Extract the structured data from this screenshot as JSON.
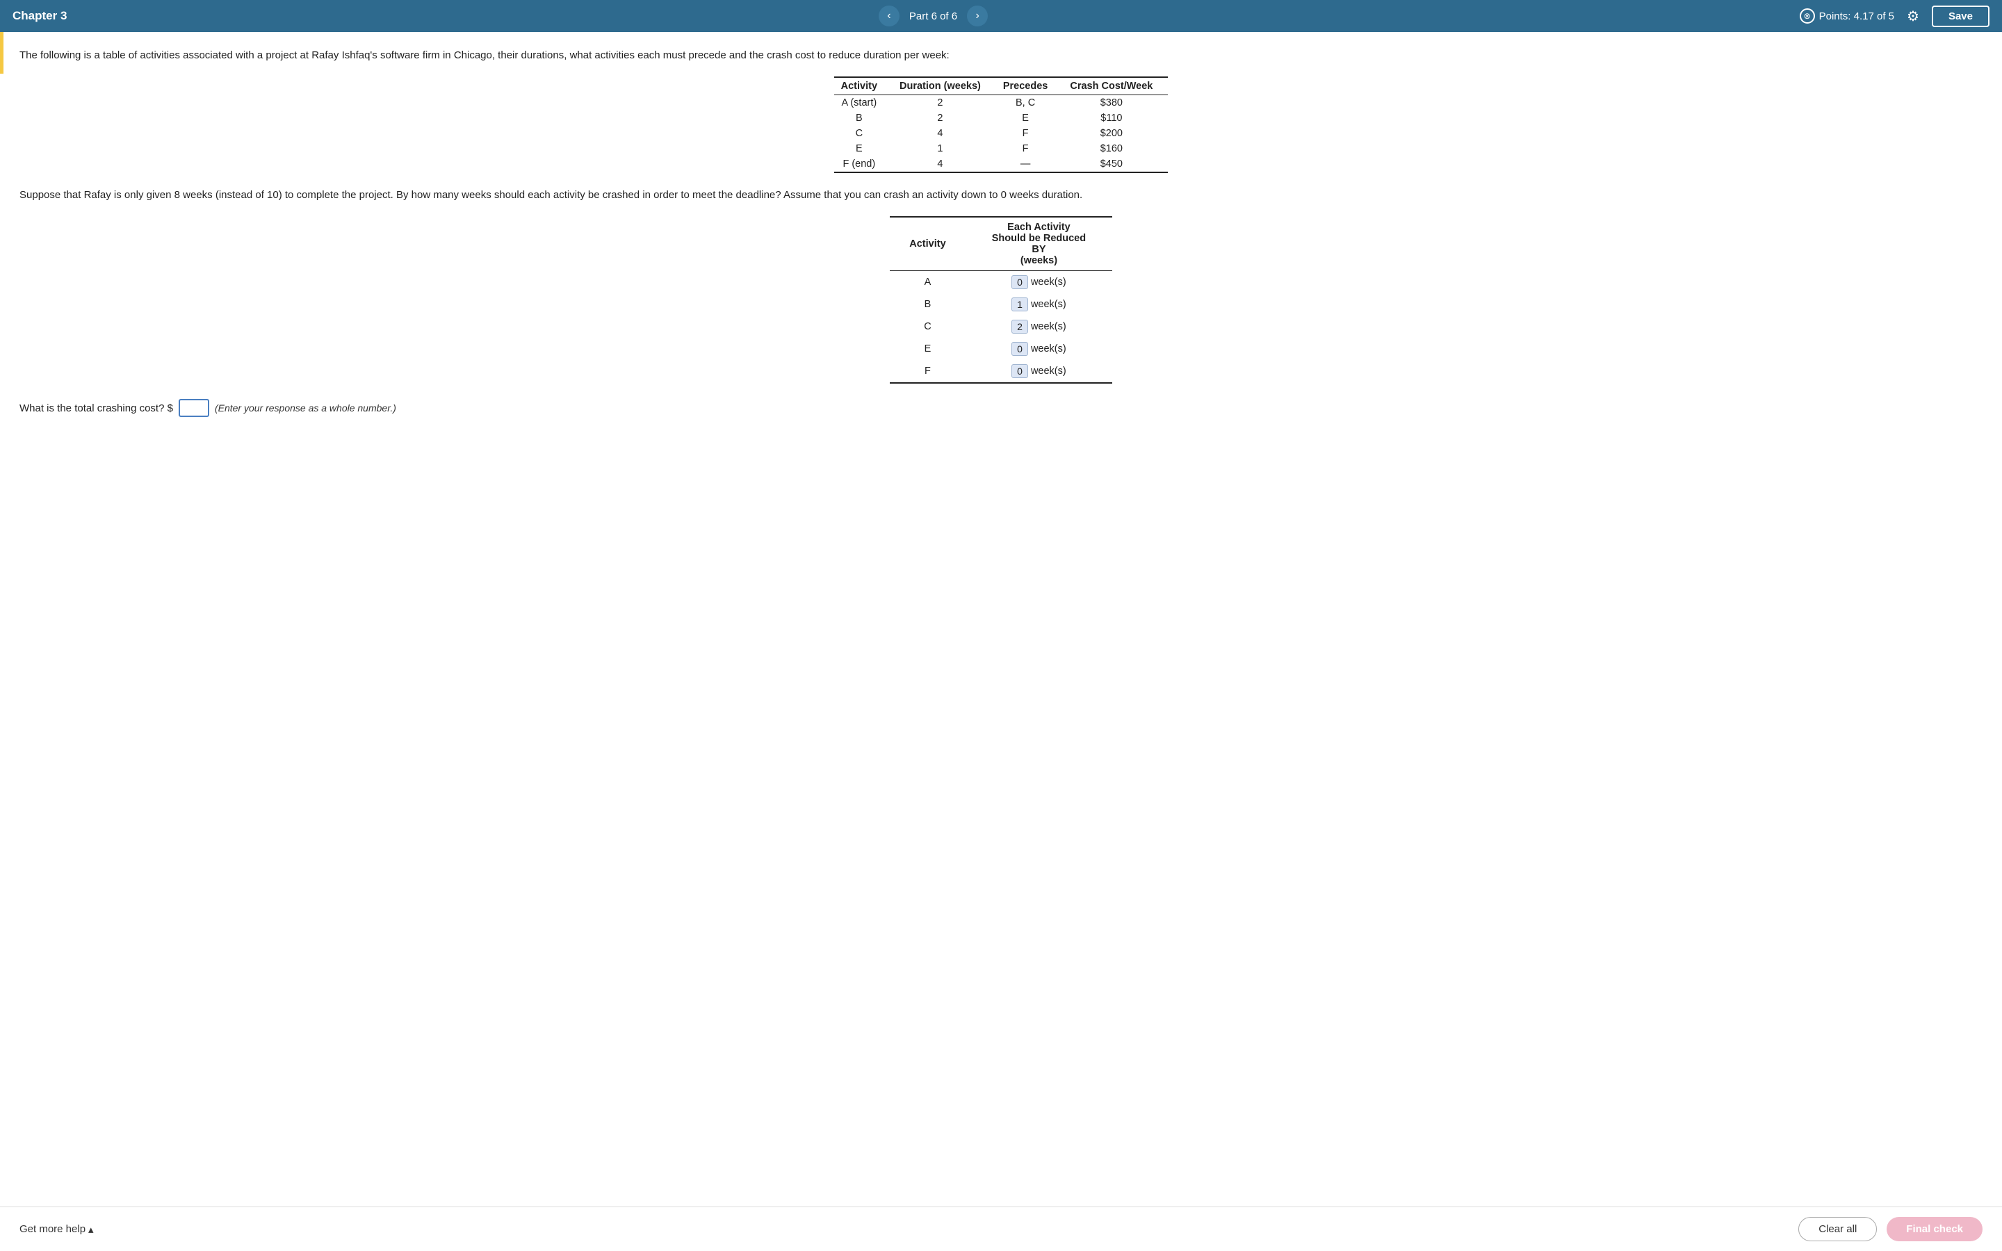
{
  "header": {
    "chapter": "Chapter 3",
    "part": "Part 6 of 6",
    "points_label": "Points: 4.17 of 5",
    "save_label": "Save"
  },
  "question_text": "The following is a table of activities associated with a project at Rafay Ishfaq's software firm in Chicago, their durations, what activities each must precede and the crash cost to reduce duration per week:",
  "activity_table": {
    "headers": [
      "Activity",
      "Duration (weeks)",
      "Precedes",
      "Crash Cost/Week"
    ],
    "rows": [
      [
        "A (start)",
        "2",
        "B, C",
        "$380"
      ],
      [
        "B",
        "2",
        "E",
        "$110"
      ],
      [
        "C",
        "4",
        "F",
        "$200"
      ],
      [
        "E",
        "1",
        "F",
        "$160"
      ],
      [
        "F (end)",
        "4",
        "—",
        "$450"
      ]
    ]
  },
  "suppose_text": "Suppose that Rafay is only given 8 weeks (instead of 10) to complete the project. By how many weeks should each activity be crashed in order to meet the deadline? Assume that you can crash an activity down to 0 weeks duration.",
  "reduction_table": {
    "col1_header": "Activity",
    "col2_header": "Each Activity Should be Reduced BY (weeks)",
    "rows": [
      {
        "activity": "A",
        "value": "0",
        "unit": "week(s)"
      },
      {
        "activity": "B",
        "value": "1",
        "unit": "week(s)"
      },
      {
        "activity": "C",
        "value": "2",
        "unit": "week(s)"
      },
      {
        "activity": "E",
        "value": "0",
        "unit": "week(s)"
      },
      {
        "activity": "F",
        "value": "0",
        "unit": "week(s)"
      }
    ]
  },
  "total_cost": {
    "label": "What is the total crashing cost? $",
    "input_value": "",
    "hint": "(Enter your response as a whole number.)"
  },
  "bottom": {
    "get_more_help": "Get more help",
    "clear_all": "Clear all",
    "final_check": "Final check"
  }
}
